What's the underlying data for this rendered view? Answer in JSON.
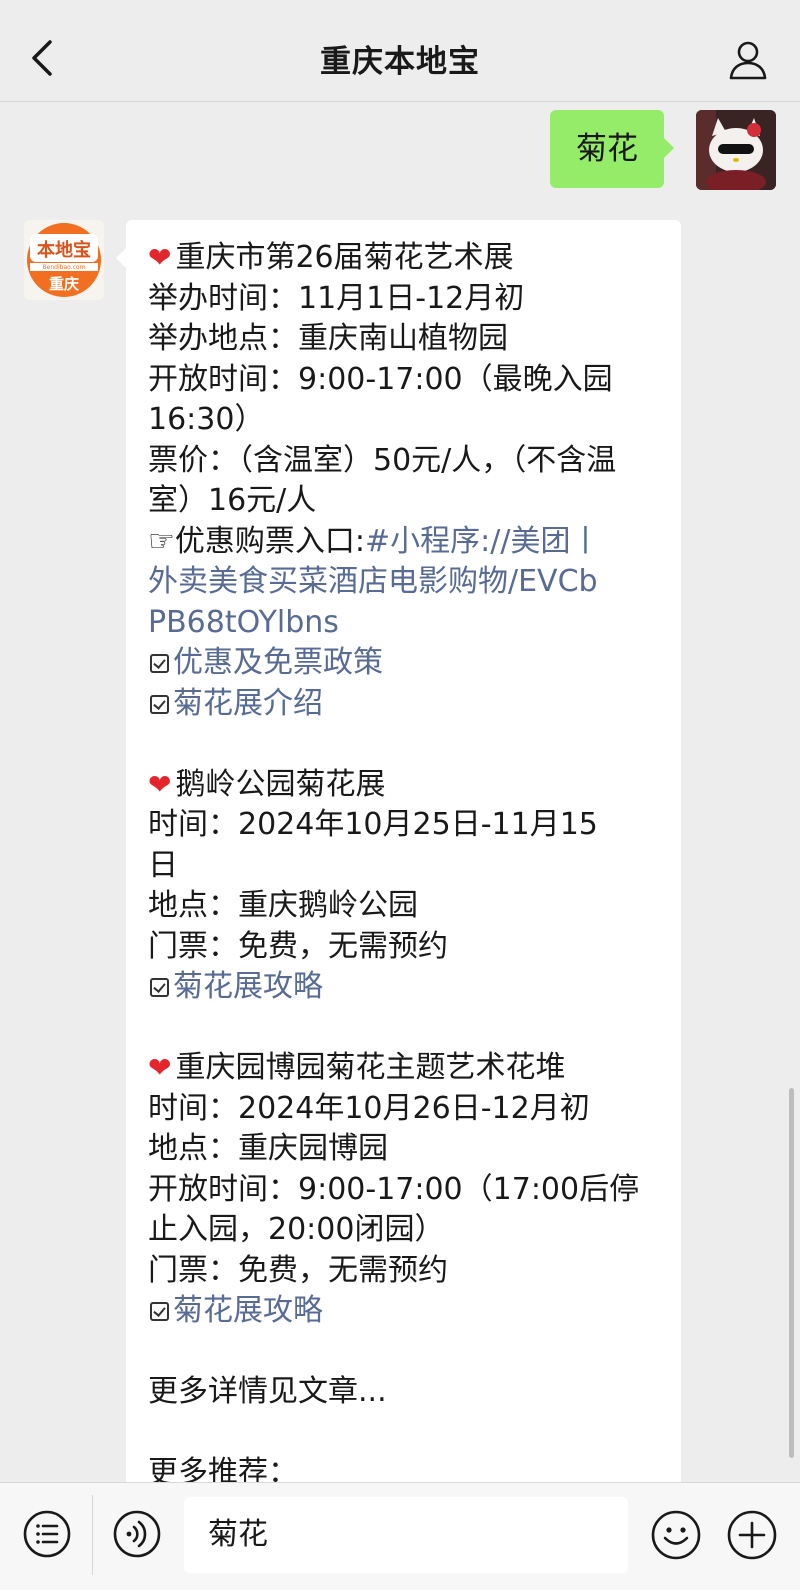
{
  "header": {
    "title": "重庆本地宝"
  },
  "outgoing": {
    "text": "菊花"
  },
  "bot_avatar": {
    "brand": "本地宝",
    "domain": "Bendibao.com",
    "city": "重庆",
    "color": "#f26f21"
  },
  "message": {
    "s1": {
      "title": "重庆市第26届菊花艺术展",
      "time": "举办时间：11月1日-12月初",
      "place": "举办地点：重庆南山植物园",
      "hours_1": "开放时间：9:00-17:00（最晚入园",
      "hours_2": "16:30）",
      "price_1": "票价：（含温室）50元/人，（不含温",
      "price_2": "室）16元/人",
      "ticket_prefix": "☞优惠购票入口:",
      "ticket_link_1": "#小程序://美团丨",
      "ticket_link_2": "外卖美食买菜酒店电影购物/EVCb",
      "ticket_link_3": "PB68tOYlbns",
      "link_policy": "优惠及免票政策",
      "link_intro": "菊花展介绍"
    },
    "s2": {
      "title": "鹅岭公园菊花展",
      "time_1": "时间：2024年10月25日-11月15",
      "time_2": "日",
      "place": "地点：重庆鹅岭公园",
      "ticket": "门票：免费，无需预约",
      "link_guide": "菊花展攻略"
    },
    "s3": {
      "title": "重庆园博园菊花主题艺术花堆",
      "time": "时间：2024年10月26日-12月初",
      "place": "地点：重庆园博园",
      "hours_1": "开放时间：9:00-17:00（17:00后停",
      "hours_2": "止入园，20:00闭园）",
      "ticket": "门票：免费，无需预约",
      "link_guide": "菊花展攻略"
    },
    "more": "更多详情见文章...",
    "more_rec": "更多推荐："
  },
  "inputbar": {
    "value": "菊花"
  },
  "colors": {
    "link": "#576b95",
    "bubble_out": "#95ec69",
    "background": "#ededed",
    "heart": "#e3262b"
  },
  "icons": [
    "back-arrow-icon",
    "profile-icon",
    "heart-icon",
    "checkbox-icon",
    "menu-list-icon",
    "voice-icon",
    "emoji-icon",
    "plus-icon"
  ]
}
